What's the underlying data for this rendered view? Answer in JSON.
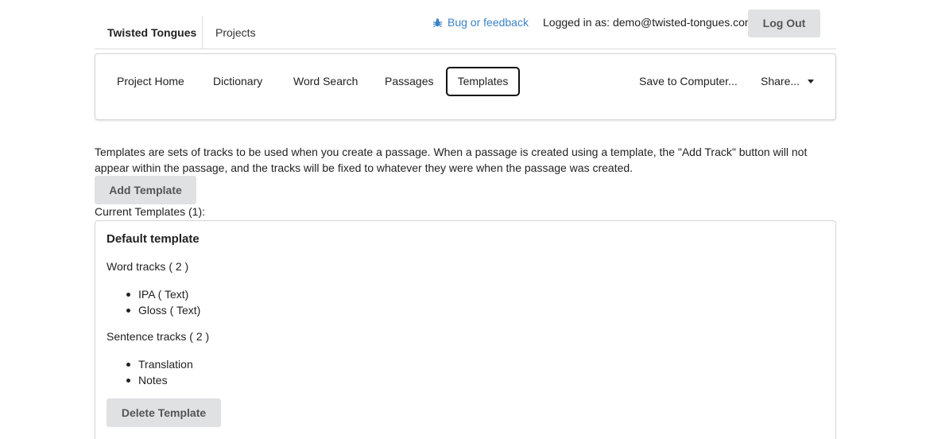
{
  "header": {
    "brand": "Twisted Tongues",
    "projects_link": "Projects",
    "bug_link": "Bug or feedback",
    "logged_in_text": "Logged in as: demo@twisted-tongues.com",
    "logout_label": "Log Out"
  },
  "tabs": {
    "project_home": "Project Home",
    "dictionary": "Dictionary",
    "word_search": "Word Search",
    "passages": "Passages",
    "templates": "Templates",
    "save": "Save to Computer...",
    "share": "Share..."
  },
  "main": {
    "description": "Templates are sets of tracks to be used when you create a passage. When a passage is created using a template, the \"Add Track\" button will not appear within the passage, and the tracks will be fixed to whatever they were when the passage was created.",
    "add_template_label": "Add Template",
    "current_templates": "Current Templates (1):",
    "template": {
      "title": "Default template",
      "word_tracks_heading": "Word tracks ( 2 )",
      "word_tracks": [
        "IPA ( Text)",
        "Gloss ( Text)"
      ],
      "sentence_tracks_heading": "Sentence tracks ( 2 )",
      "sentence_tracks": [
        "Translation",
        "Notes"
      ],
      "delete_label": "Delete Template"
    }
  },
  "colors": {
    "link": "#3b82c4",
    "button_bg": "#e0e1e2",
    "border": "#d4d4d5"
  }
}
